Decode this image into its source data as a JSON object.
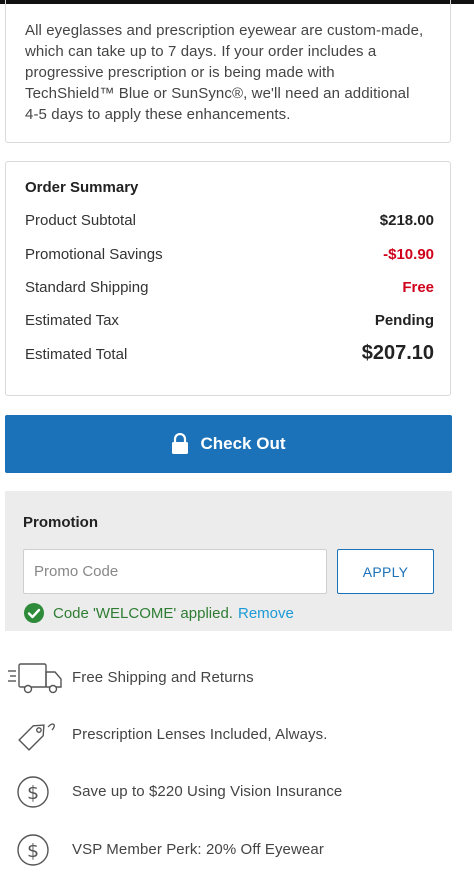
{
  "info": {
    "text": "All eyeglasses and prescription eyewear are custom-made, which can take up to 7 days. If your order includes a progressive prescription or is being made with TechShield™ Blue or SunSync®, we'll need an additional 4-5 days to apply these enhancements."
  },
  "summary": {
    "title": "Order Summary",
    "rows": [
      {
        "label": "Product Subtotal",
        "value": "$218.00"
      },
      {
        "label": "Promotional Savings",
        "value": "-$10.90"
      },
      {
        "label": "Standard Shipping",
        "value": "Free"
      },
      {
        "label": "Estimated Tax",
        "value": "Pending"
      },
      {
        "label": "Estimated Total",
        "value": "$207.10"
      }
    ]
  },
  "checkout": {
    "label": "Check Out"
  },
  "promo": {
    "title": "Promotion",
    "placeholder": "Promo Code",
    "value": "",
    "apply_label": "APPLY",
    "applied_message": "Code 'WELCOME' applied.",
    "remove_label": "Remove"
  },
  "features": [
    {
      "icon": "truck-icon",
      "label": "Free Shipping and Returns"
    },
    {
      "icon": "tag-icon",
      "label": "Prescription Lenses Included, Always."
    },
    {
      "icon": "dollar-circle-icon",
      "label": "Save up to $220 Using Vision Insurance"
    },
    {
      "icon": "dollar-circle-icon",
      "label": "VSP Member Perk: 20% Off Eyewear"
    }
  ],
  "colors": {
    "primary": "#1b72b9",
    "savings_red": "#d0021b",
    "success_green": "#2e7d32",
    "link_blue": "#1a9bd7",
    "promo_bg": "#ececec"
  }
}
